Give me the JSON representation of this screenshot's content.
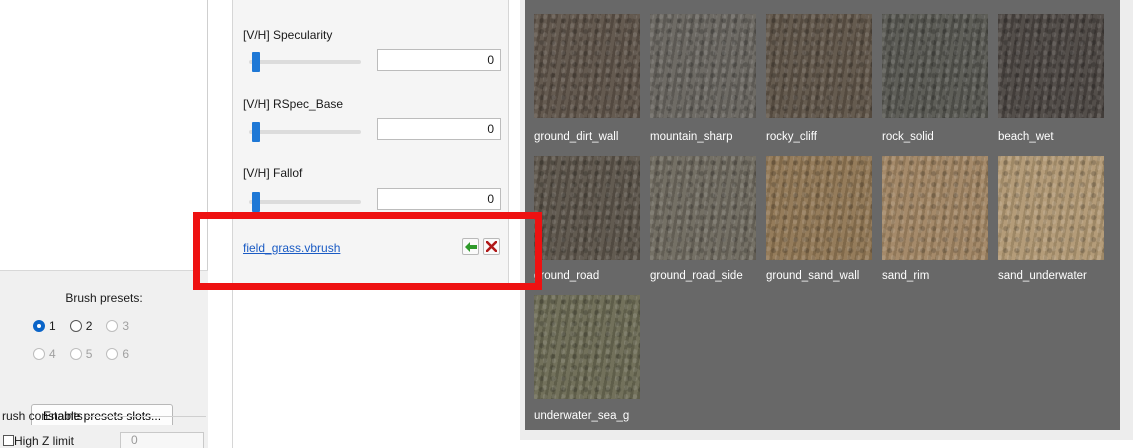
{
  "presets": {
    "title": "Brush presets:",
    "radios": [
      {
        "label": "1",
        "checked": true,
        "disabled": false
      },
      {
        "label": "2",
        "checked": false,
        "disabled": false
      },
      {
        "label": "3",
        "checked": false,
        "disabled": true
      },
      {
        "label": "4",
        "checked": false,
        "disabled": true
      },
      {
        "label": "5",
        "checked": false,
        "disabled": true
      },
      {
        "label": "6",
        "checked": false,
        "disabled": true
      }
    ],
    "enable_button": "Enable presets slots..."
  },
  "constraints": {
    "group_label": "rush constaints",
    "high_z_label": "High Z limit",
    "high_z_value": "0"
  },
  "params": [
    {
      "label": "[V/H] Specularity",
      "value": "0"
    },
    {
      "label": "[V/H] RSpec_Base",
      "value": "0"
    },
    {
      "label": "[V/H] Fallof",
      "value": "0"
    }
  ],
  "brush_file": "field_grass.vbrush",
  "textures": [
    {
      "name": "ground_dirt_wall",
      "color": "#5c5147"
    },
    {
      "name": "mountain_sharp",
      "color": "#66635d"
    },
    {
      "name": "rocky_cliff",
      "color": "#5d5246"
    },
    {
      "name": "rock_solid",
      "color": "#55554f"
    },
    {
      "name": "beach_wet",
      "color": "#4a4440"
    },
    {
      "name": "ground_road",
      "color": "#5a5248"
    },
    {
      "name": "ground_road_side",
      "color": "#6d685d"
    },
    {
      "name": "ground_sand_wall",
      "color": "#8f7552"
    },
    {
      "name": "sand_rim",
      "color": "#a08462"
    },
    {
      "name": "sand_underwater",
      "color": "#b09772"
    },
    {
      "name": "underwater_sea_g",
      "color": "#6a6952"
    }
  ],
  "colors": {
    "highlight": "#ee1111",
    "slider_thumb": "#1e78d6",
    "panel_gray": "#686868",
    "link_blue": "#1a5bc4"
  }
}
